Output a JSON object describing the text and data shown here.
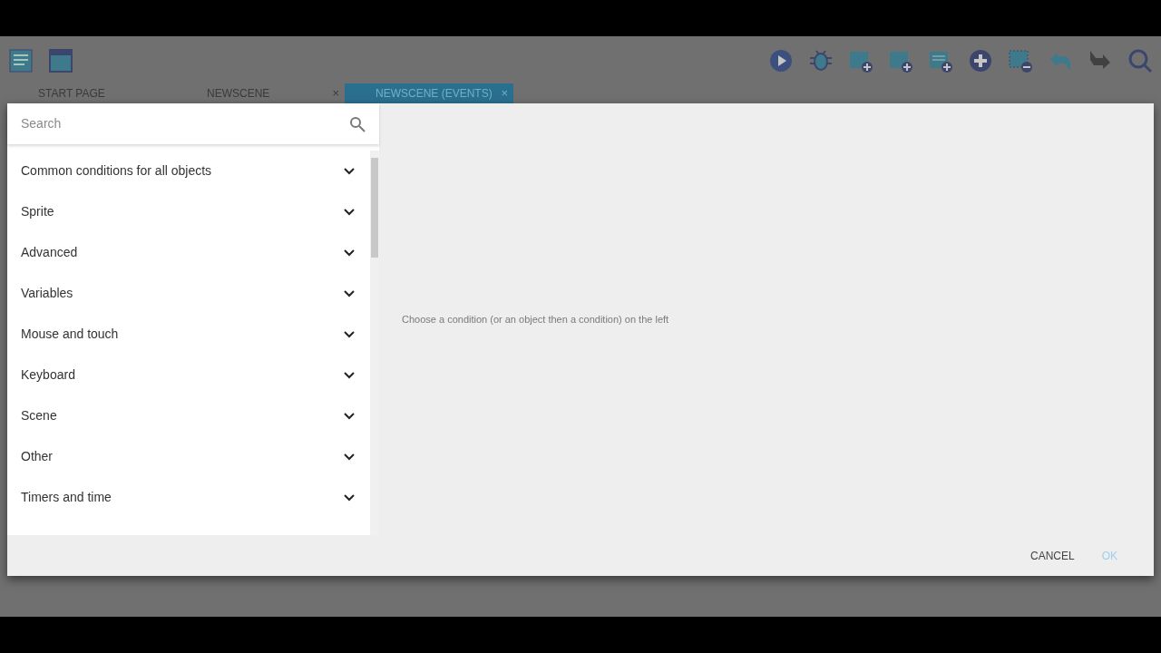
{
  "tabs": [
    {
      "label": "START PAGE",
      "selected": false,
      "closable": false
    },
    {
      "label": "NEWSCENE",
      "selected": false,
      "closable": true
    },
    {
      "label": "NEWSCENE (EVENTS)",
      "selected": true,
      "closable": true
    }
  ],
  "close_glyph": "×",
  "search": {
    "placeholder": "Search"
  },
  "categories": [
    {
      "label": "Common conditions for all objects",
      "expanded": false
    },
    {
      "label": "Sprite",
      "expanded": false
    },
    {
      "label": "Advanced",
      "expanded": false
    },
    {
      "label": "Variables",
      "expanded": false
    },
    {
      "label": "Mouse and touch",
      "expanded": false
    },
    {
      "label": "Keyboard",
      "expanded": false
    },
    {
      "label": "Scene",
      "expanded": false
    },
    {
      "label": "Other",
      "expanded": false
    },
    {
      "label": "Timers and time",
      "expanded": false
    }
  ],
  "hint": "Choose a condition (or an object then a condition) on the left",
  "buttons": [
    {
      "label": "CANCEL",
      "kind": "secondary"
    },
    {
      "label": "OK",
      "kind": "primary"
    }
  ]
}
